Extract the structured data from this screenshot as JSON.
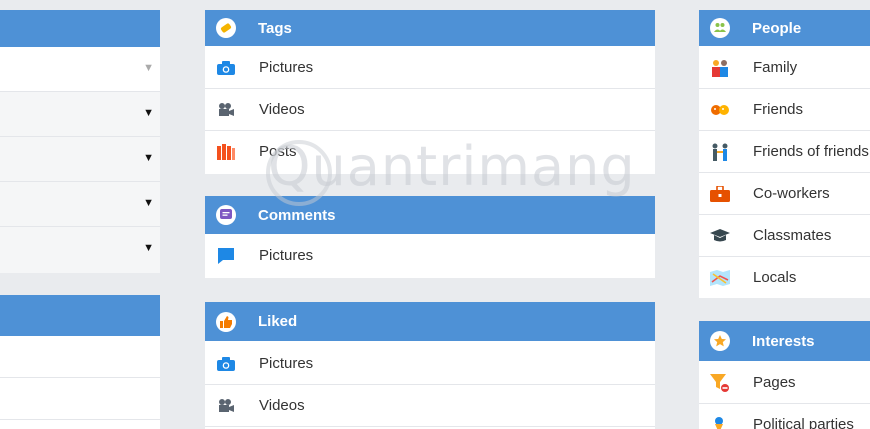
{
  "left_column": {
    "dropdowns": [
      {
        "caret": "▼",
        "muted": true
      },
      {
        "caret": "▼",
        "muted": false
      },
      {
        "caret": "▼",
        "muted": false
      },
      {
        "caret": "▼",
        "muted": false
      },
      {
        "caret": "▼",
        "muted": false
      }
    ]
  },
  "tags": {
    "title": "Tags",
    "items": [
      {
        "label": "Pictures",
        "icon": "camera-icon"
      },
      {
        "label": "Videos",
        "icon": "video-camera-icon"
      },
      {
        "label": "Posts",
        "icon": "posts-icon"
      }
    ]
  },
  "comments": {
    "title": "Comments",
    "items": [
      {
        "label": "Pictures",
        "icon": "speech-bubble-icon"
      }
    ]
  },
  "liked": {
    "title": "Liked",
    "items": [
      {
        "label": "Pictures",
        "icon": "camera-icon"
      },
      {
        "label": "Videos",
        "icon": "video-camera-icon"
      }
    ]
  },
  "people": {
    "title": "People",
    "items": [
      {
        "label": "Family",
        "icon": "family-icon"
      },
      {
        "label": "Friends",
        "icon": "friends-icon"
      },
      {
        "label": "Friends of friends",
        "icon": "friends-of-friends-icon"
      },
      {
        "label": "Co-workers",
        "icon": "briefcase-icon"
      },
      {
        "label": "Classmates",
        "icon": "graduation-cap-icon"
      },
      {
        "label": "Locals",
        "icon": "map-icon"
      }
    ]
  },
  "interests": {
    "title": "Interests",
    "items": [
      {
        "label": "Pages",
        "icon": "filter-icon"
      },
      {
        "label": "Political parties",
        "icon": "political-party-icon"
      }
    ]
  },
  "watermark": "Quantrimang",
  "colors": {
    "header": "#4e91d6",
    "background": "#e9ebee"
  }
}
